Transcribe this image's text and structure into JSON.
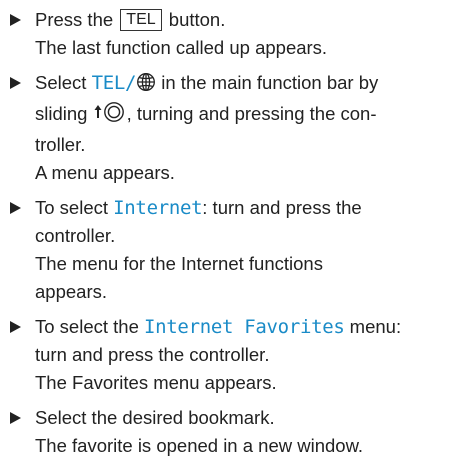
{
  "steps": [
    {
      "action_prefix": "Press the",
      "key_label": "TEL",
      "action_suffix": "button.",
      "result": "The last function called up appears."
    },
    {
      "action_line1_prefix": "Select",
      "highlight": "TEL/",
      "action_line1_suffix": "in the main function bar by",
      "action_line2_prefix": "sliding",
      "action_line2_suffix": ", turning and pressing the con-",
      "action_line3": "troller.",
      "result": "A menu appears."
    },
    {
      "action_line1_prefix": "To select",
      "highlight": "Internet",
      "action_line1_suffix": ": turn and press the",
      "action_line2": "controller.",
      "result_line1": "The menu for the Internet functions",
      "result_line2": "appears."
    },
    {
      "action_line1_prefix": "To select the",
      "highlight": "Internet Favorites",
      "action_line1_suffix": "menu:",
      "action_line2": "turn and press the controller.",
      "result": "The Favorites menu appears."
    },
    {
      "action": "Select the desired bookmark.",
      "result": "The favorite is opened in a new window."
    }
  ],
  "colors": {
    "text": "#222222",
    "highlight": "#1a8bc7"
  },
  "icons": {
    "globe": "globe-icon",
    "controller": "controller-slide-up-icon",
    "bullet": "triangle-bullet-icon"
  }
}
